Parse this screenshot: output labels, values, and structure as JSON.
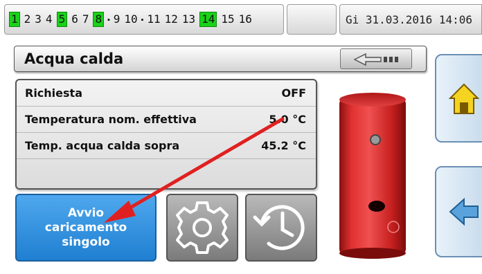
{
  "status_bar": {
    "outputs": [
      {
        "label": "1",
        "active": true
      },
      {
        "label": "2",
        "active": false
      },
      {
        "label": "3",
        "active": false
      },
      {
        "label": "4",
        "active": false
      },
      {
        "label": "5",
        "active": true
      },
      {
        "label": "6",
        "active": false
      },
      {
        "label": "7",
        "active": false
      },
      {
        "label": "8",
        "active": true
      },
      {
        "label": "9",
        "active": false
      },
      {
        "label": "10",
        "active": false
      },
      {
        "label": "11",
        "active": false
      },
      {
        "label": "12",
        "active": false
      },
      {
        "label": "13",
        "active": false
      },
      {
        "label": "14",
        "active": true
      },
      {
        "label": "15",
        "active": false
      },
      {
        "label": "16",
        "active": false
      }
    ],
    "datetime": "Gi  31.03.2016  14:06"
  },
  "page": {
    "title": "Acqua calda"
  },
  "info_rows": [
    {
      "label": "Richiesta",
      "value": "OFF"
    },
    {
      "label": "Temperatura nom. effettiva",
      "value": "5.0 °C"
    },
    {
      "label": "Temp. acqua calda sopra",
      "value": "45.2 °C"
    }
  ],
  "buttons": {
    "single_charge_line1": "Avvio",
    "single_charge_line2": "caricamento",
    "single_charge_line3": "singolo"
  },
  "icons": {
    "back": "back-arrow-icon",
    "settings": "gear-icon",
    "history": "history-clock-icon",
    "home": "home-icon",
    "nav_back": "left-arrow-icon"
  },
  "colors": {
    "active_output": "#19d219",
    "primary_button": "#2f8fe0",
    "annotation_arrow": "#e02020",
    "tank": "#d42a2a"
  }
}
